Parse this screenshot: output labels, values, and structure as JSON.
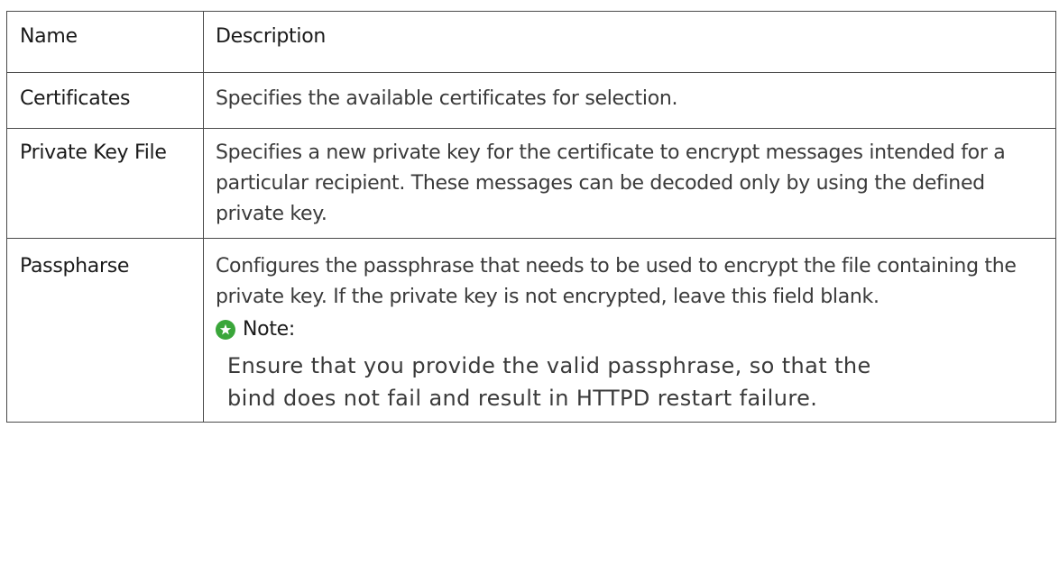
{
  "table": {
    "header": {
      "name": "Name",
      "description": "Description"
    },
    "rows": [
      {
        "name": "Certificates",
        "description": "Specifies the available certificates for selection."
      },
      {
        "name": "Private Key File",
        "description": "Specifies a new private key for the certificate to encrypt messages intended for a particular recipient. These messages can be decoded only by using the defined private key."
      },
      {
        "name": "Passpharse",
        "description": "Configures the passphrase that needs to be used to encrypt the file containing the private key. If the private key is not encrypted, leave this field blank.",
        "note": {
          "icon": "note-star-icon",
          "label": "Note:",
          "text": "Ensure that you provide the valid passphrase, so that the bind does not fail and result in HTTPD restart failure."
        }
      }
    ]
  },
  "colors": {
    "note_icon": "#3aa63a",
    "border": "#4a4a4a"
  }
}
